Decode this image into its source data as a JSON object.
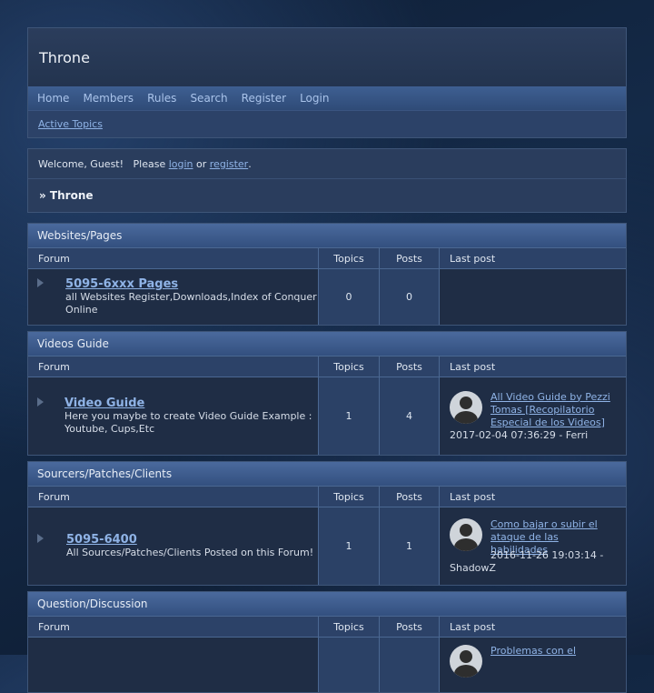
{
  "site": {
    "title": "Throne",
    "nav": [
      "Home",
      "Members",
      "Rules",
      "Search",
      "Register",
      "Login"
    ],
    "subnav": "Active Topics"
  },
  "welcome": {
    "prefix": "Welcome, Guest!   Please ",
    "login": "login",
    "or": " or ",
    "register": "register",
    "suffix": ".",
    "breadcrumb": "» Throne"
  },
  "columns": {
    "forum": "Forum",
    "topics": "Topics",
    "posts": "Posts",
    "last": "Last post"
  },
  "categories": [
    {
      "title": "Websites/Pages",
      "forum": {
        "name": "5095-6xxx Pages",
        "desc": "all Websites Register,Downloads,Index of Conquer Online",
        "topics": "0",
        "posts": "0"
      }
    },
    {
      "title": "Videos Guide",
      "forum": {
        "name": "Video Guide",
        "desc": "Here you maybe to create Video Guide Example : Youtube, Cups,Etc",
        "topics": "1",
        "posts": "4",
        "last_title": "All Video Guide by Pezzi Tomas [Recopilatorio Especial de los Videos]",
        "last_meta": "2017-02-04 07:36:29 - Ferri"
      }
    },
    {
      "title": "Sourcers/Patches/Clients",
      "forum": {
        "name": "5095-6400",
        "desc": "All Sources/Patches/Clients Posted on this Forum!",
        "topics": "1",
        "posts": "1",
        "last_title": "Como bajar o subir el ataque de las habilidades",
        "last_meta": "2016-11-26 19:03:14 - ShadowZ"
      }
    },
    {
      "title": "Question/Discussion",
      "forum": {
        "last_title": "Problemas con el"
      }
    }
  ]
}
